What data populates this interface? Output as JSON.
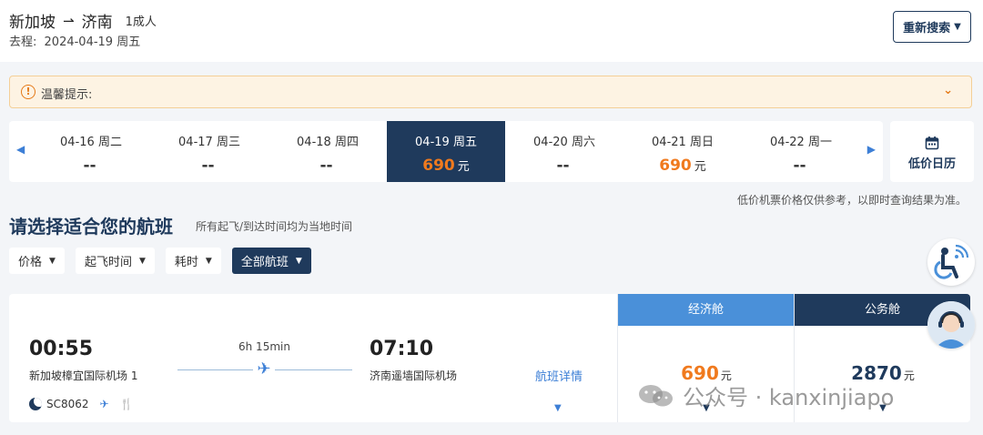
{
  "header": {
    "origin": "新加坡",
    "destination": "济南",
    "passengers": "1成人",
    "trip_label": "去程:",
    "trip_date": "2024-04-19 周五",
    "research_label": "重新搜索"
  },
  "notice": {
    "label": "温馨提示:"
  },
  "date_bar": {
    "days": [
      {
        "label": "04-16 周二",
        "price": "--",
        "unit": ""
      },
      {
        "label": "04-17 周三",
        "price": "--",
        "unit": ""
      },
      {
        "label": "04-18 周四",
        "price": "--",
        "unit": ""
      },
      {
        "label": "04-19 周五",
        "price": "690",
        "unit": "元"
      },
      {
        "label": "04-20 周六",
        "price": "--",
        "unit": ""
      },
      {
        "label": "04-21 周日",
        "price": "690",
        "unit": "元"
      },
      {
        "label": "04-22 周一",
        "price": "--",
        "unit": ""
      }
    ],
    "selected_index": 3,
    "low_price_calendar": "低价日历"
  },
  "disclaimer": "低价机票价格仅供参考，以即时查询结果为准。",
  "section": {
    "title": "请选择适合您的航班",
    "subtitle": "所有起飞/到达时间均为当地时间"
  },
  "filters": [
    {
      "label": "价格"
    },
    {
      "label": "起飞时间"
    },
    {
      "label": "耗时"
    },
    {
      "label": "全部航班",
      "active": true
    }
  ],
  "flight": {
    "departure_time": "00:55",
    "departure_airport": "新加坡樟宜国际机场 1",
    "duration": "6h 15min",
    "arrival_time": "07:10",
    "arrival_airport": "济南遥墙国际机场",
    "detail_link": "航班详情",
    "flight_number": "SC8062",
    "cabins": [
      {
        "name": "经济舱",
        "price": "690",
        "unit": "元"
      },
      {
        "name": "公务舱",
        "price": "2870",
        "unit": "元"
      }
    ]
  },
  "watermark": "公众号 · kanxinjiapo",
  "colors": {
    "navy": "#1f3a5c",
    "accent_orange": "#f07a1e",
    "economy_blue": "#4a90d9",
    "link_blue": "#3d7fd6"
  }
}
